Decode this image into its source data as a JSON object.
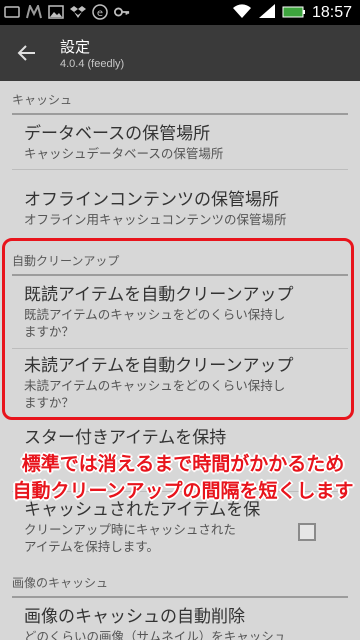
{
  "status_bar": {
    "time": "18:57"
  },
  "action_bar": {
    "title": "設定",
    "subtitle": "4.0.4 (feedly)"
  },
  "sections": {
    "cache": {
      "header": "キャッシュ",
      "items": [
        {
          "title": "データベースの保管場所",
          "summary": "キャッシュデータベースの保管場所"
        },
        {
          "title": "オフラインコンテンツの保管場所",
          "summary": "オフライン用キャッシュコンテンツの保管場所"
        }
      ]
    },
    "auto_cleanup": {
      "header": "自動クリーンアップ",
      "items": [
        {
          "title": "既読アイテムを自動クリーンアップ",
          "summary_line1": "既読アイテムのキャッシュをどのくらい保持し",
          "summary_line2": "ますか？"
        },
        {
          "title": "未読アイテムを自動クリーンアップ",
          "summary_line1": "未読アイテムのキャッシュをどのくらい保持し",
          "summary_line2": "ますか？"
        },
        {
          "title": "スター付きアイテムを保持",
          "summary": ""
        },
        {
          "title": "キャッシュされたアイテムを保",
          "summary_line1": "クリーンアップ時にキャッシュされた",
          "summary_line2": "アイテムを保持します。"
        }
      ]
    },
    "image_cache": {
      "header": "画像のキャッシュ",
      "items": [
        {
          "title": "画像のキャッシュの自動削除",
          "summary": "どのくらいの画像（サムネイル）をキャッシュ"
        }
      ]
    }
  },
  "annotation": {
    "line1": "標準では消えるまで時間がかかるため",
    "line2": "自動クリーンアップの間隔を短くします",
    "color": "#e8141c"
  }
}
